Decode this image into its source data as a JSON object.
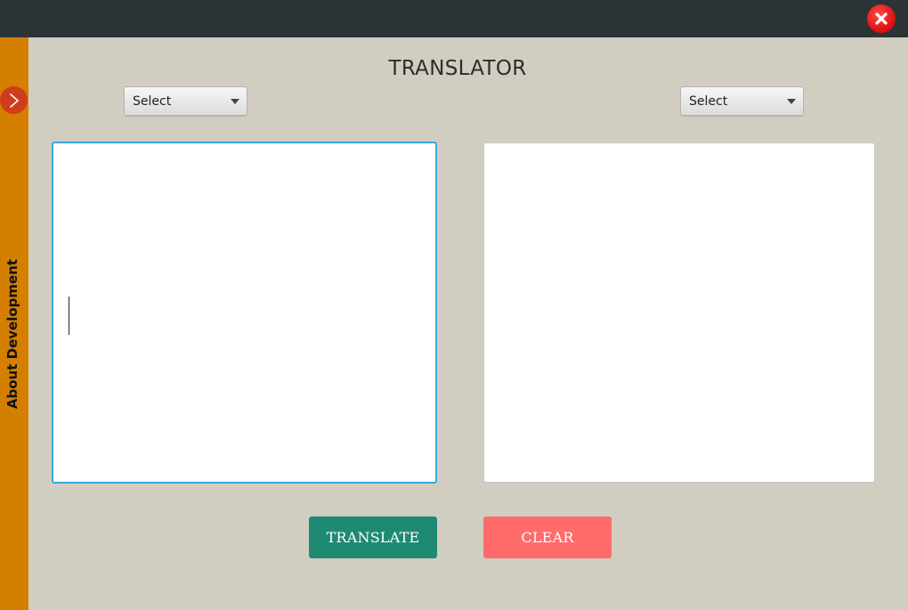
{
  "window": {
    "close_icon": "close-icon"
  },
  "sidebar": {
    "label": "About Development",
    "toggle_icon": "chevron-right-icon",
    "toggle_glyph": ">"
  },
  "main": {
    "title": "TRANSLATOR",
    "source_language": {
      "selected": "Select",
      "dropdown_icon": "caret-down-icon"
    },
    "target_language": {
      "selected": "Select",
      "dropdown_icon": "caret-down-icon"
    },
    "input_text": "",
    "output_text": ""
  },
  "actions": {
    "translate_label": "TRANSLATE",
    "clear_label": "CLEAR"
  },
  "colors": {
    "background": "#d1cdc1",
    "titlebar": "#2c3336",
    "sidebar": "#d47f00",
    "sidebar_toggle": "#cf3d1c",
    "close_button": "#e01414",
    "input_focus_border": "#3aa8dc",
    "translate_button": "#1f8a73",
    "clear_button": "#ff6b6b"
  }
}
